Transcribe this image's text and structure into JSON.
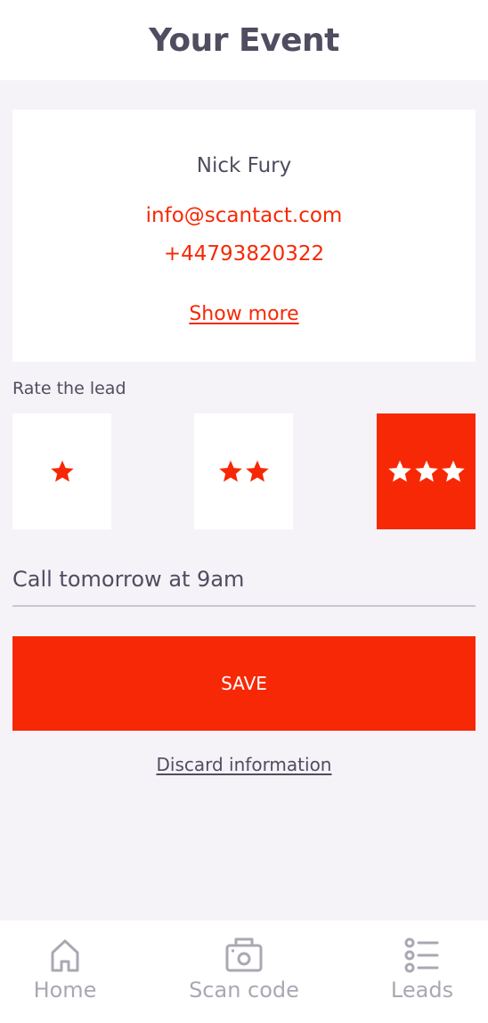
{
  "header": {
    "title": "Your Event"
  },
  "contact": {
    "name": "Nick Fury",
    "email": "info@scantact.com",
    "phone": "+44793820322",
    "show_more_label": "Show more"
  },
  "rating": {
    "label": "Rate the lead",
    "options": [
      {
        "stars": 1,
        "selected": false
      },
      {
        "stars": 2,
        "selected": false
      },
      {
        "stars": 3,
        "selected": true
      }
    ],
    "selected_value": 3
  },
  "note": {
    "value": "Call tomorrow at 9am"
  },
  "actions": {
    "save_label": "SAVE",
    "discard_label": "Discard information"
  },
  "nav": {
    "items": [
      {
        "label": "Home",
        "icon": "home-icon"
      },
      {
        "label": "Scan code",
        "icon": "camera-icon"
      },
      {
        "label": "Leads",
        "icon": "list-icon"
      }
    ]
  },
  "colors": {
    "accent": "#f72805",
    "background": "#f5f3f8",
    "text": "#4f4d5f",
    "nav_inactive": "#a9a8b3"
  }
}
